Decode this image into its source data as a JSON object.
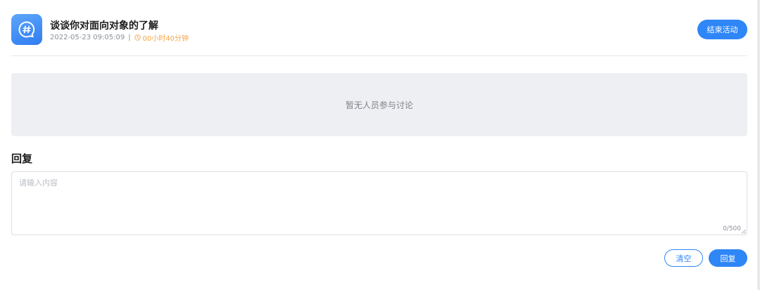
{
  "topic": {
    "icon": "hashtag-chat-icon",
    "title": "谈谈你对面向对象的了解",
    "timestamp": "2022-05-23 09:05:09",
    "separator": "|",
    "duration_icon": "clock-icon",
    "duration": "00小时40分钟",
    "end_button_label": "结束活动"
  },
  "discussion": {
    "empty_text": "暂无人员参与讨论"
  },
  "reply": {
    "heading": "回复",
    "placeholder": "请输入内容",
    "value": "",
    "counter": "0/500",
    "clear_label": "清空",
    "submit_label": "回复"
  },
  "colors": {
    "accent": "#2f86f6",
    "duration": "#f5a54a",
    "empty_panel": "#eeeff2"
  }
}
